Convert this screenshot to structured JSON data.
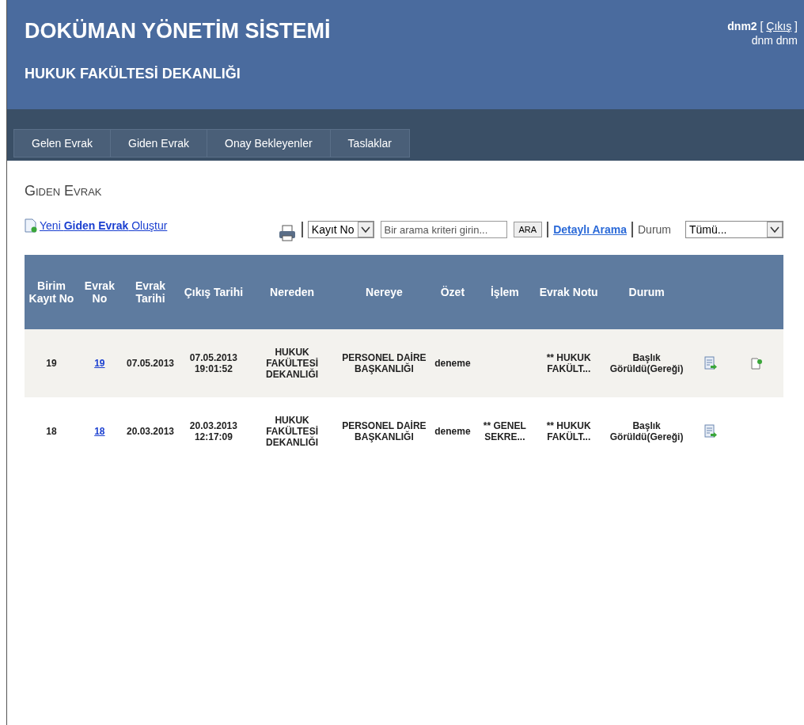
{
  "header": {
    "title": "DOKÜMAN YÖNETİM SİSTEMİ",
    "subtitle": "HUKUK FAKÜLTESİ DEKANLIĞI",
    "user": "dnm2",
    "logout": "Çıkış",
    "bracket_open": "[",
    "bracket_close": "]",
    "full_name": "dnm dnm"
  },
  "tabs": [
    {
      "label": "Gelen Evrak"
    },
    {
      "label": "Giden Evrak"
    },
    {
      "label": "Onay Bekleyenler"
    },
    {
      "label": "Taslaklar"
    }
  ],
  "page_title": "Giden Evrak",
  "new_link": "Yeni **Giden Evrak** Oluştur",
  "toolbar": {
    "search_by": "Kayıt No",
    "search_placeholder": "Bir arama kriteri girin...",
    "search_button": "ARA",
    "detailed_search": "Detaylı Arama",
    "status_label": "Durum",
    "status_value": "Tümü..."
  },
  "table": {
    "columns": [
      "Birim Kayıt No",
      "Evrak No",
      "Evrak Tarihi",
      "Çıkış Tarihi",
      "Nereden",
      "Nereye",
      "Özet",
      "İşlem",
      "Evrak Notu",
      "Durum"
    ],
    "rows": [
      {
        "cells": [
          "19",
          "19",
          "07.05.2013",
          "07.05.2013 19:01:52",
          "HUKUK FAKÜLTESİ DEKANLIĞI",
          "PERSONEL DAİRE BAŞKANLIĞI",
          "deneme",
          "",
          "** HUKUK FAKÜLT...",
          "Başlık Görüldü(Gereği)"
        ],
        "actions": [
          {
            "kind": "forward"
          },
          {
            "kind": "add"
          }
        ]
      },
      {
        "cells": [
          "18",
          "18",
          "20.03.2013",
          "20.03.2013 12:17:09",
          "HUKUK FAKÜLTESİ DEKANLIĞI",
          "PERSONEL DAİRE BAŞKANLIĞI",
          "deneme",
          "** GENEL SEKRE...",
          "** HUKUK FAKÜLT...",
          "Başlık Görüldü(Gereği)"
        ],
        "actions": [
          {
            "kind": "forward"
          }
        ]
      }
    ]
  }
}
